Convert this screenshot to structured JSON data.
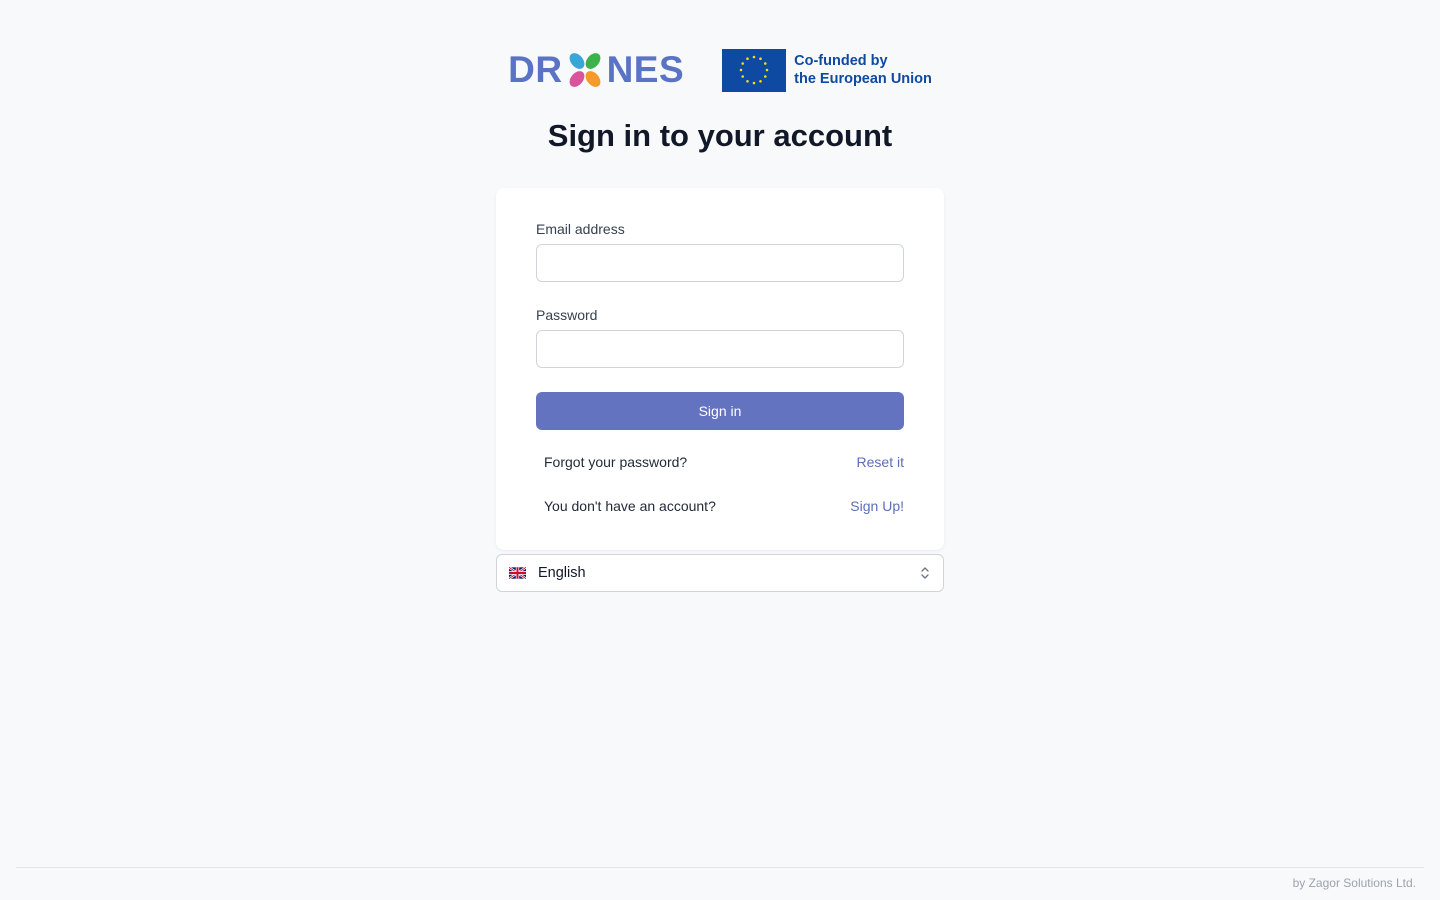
{
  "brand": {
    "drones_prefix": "DR",
    "drones_suffix": "NES",
    "eu_line1": "Co-funded by",
    "eu_line2": "the European Union"
  },
  "title": "Sign in to your account",
  "form": {
    "email_label": "Email address",
    "email_value": "",
    "password_label": "Password",
    "password_value": "",
    "submit_label": "Sign in"
  },
  "links": {
    "forgot_text": "Forgot your password?",
    "forgot_link": "Reset it",
    "signup_text": "You don't have an account?",
    "signup_link": "Sign Up!"
  },
  "language": {
    "selected": "English",
    "flag_icon": "uk-flag-icon"
  },
  "footer": {
    "credit": "by Zagor Solutions Ltd."
  },
  "colors": {
    "accent": "#6373c0",
    "link": "#5b6fb8",
    "background": "#f8f9fb"
  }
}
